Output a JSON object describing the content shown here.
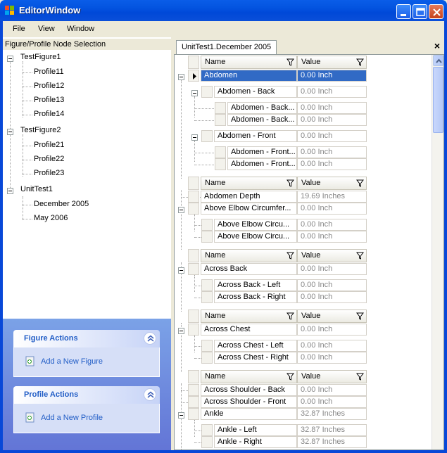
{
  "window": {
    "title": "EditorWindow"
  },
  "menu": [
    "File",
    "View",
    "Window"
  ],
  "left": {
    "header": "Figure/Profile Node Selection",
    "tree": [
      {
        "label": "TestFigure1",
        "children": [
          "Profile11",
          "Profile12",
          "Profile13",
          "Profile14"
        ]
      },
      {
        "label": "TestFigure2",
        "children": [
          "Profile21",
          "Profile22",
          "Profile23"
        ]
      },
      {
        "label": "UnitTest1",
        "children": [
          "December 2005",
          "May 2006"
        ]
      }
    ]
  },
  "tasks": {
    "figure": {
      "title": "Figure Actions",
      "link": "Add a New Figure"
    },
    "profile": {
      "title": "Profile Actions",
      "link": "Add a New Profile"
    }
  },
  "right": {
    "tab": "UnitTest1.December 2005",
    "close": "×",
    "headers": {
      "name": "Name",
      "value": "Value"
    },
    "rows": [
      {
        "name": "Abdomen",
        "value": "0.00 Inch"
      },
      {
        "name": "Abdomen - Back",
        "value": "0.00 Inch"
      },
      {
        "name": "Abdomen - Back...",
        "value": "0.00 Inch"
      },
      {
        "name": "Abdomen - Back...",
        "value": "0.00 Inch"
      },
      {
        "name": "Abdomen - Front",
        "value": "0.00 Inch"
      },
      {
        "name": "Abdomen  - Front...",
        "value": "0.00 Inch"
      },
      {
        "name": "Abdomen - Front...",
        "value": "0.00 Inch"
      },
      {
        "name": "Abdomen Depth",
        "value": "19.69 Inches"
      },
      {
        "name": "Above Elbow Circumfer...",
        "value": "0.00 Inch"
      },
      {
        "name": "Above Elbow Circu...",
        "value": "0.00 Inch"
      },
      {
        "name": "Above Elbow Circu...",
        "value": "0.00 Inch"
      },
      {
        "name": "Across Back",
        "value": "0.00 Inch"
      },
      {
        "name": "Across Back - Left",
        "value": "0.00 Inch"
      },
      {
        "name": "Across Back - Right",
        "value": "0.00 Inch"
      },
      {
        "name": "Across Chest",
        "value": "0.00 Inch"
      },
      {
        "name": "Across Chest - Left",
        "value": "0.00 Inch"
      },
      {
        "name": "Across Chest - Right",
        "value": "0.00 Inch"
      },
      {
        "name": "Across Shoulder - Back",
        "value": "0.00 Inch"
      },
      {
        "name": "Across Shoulder - Front",
        "value": "0.00 Inch"
      },
      {
        "name": "Ankle",
        "value": "32.87 Inches"
      },
      {
        "name": "Ankle - Left",
        "value": "32.87 Inches"
      },
      {
        "name": "Ankle - Right",
        "value": "32.87 Inches"
      }
    ]
  },
  "colors": {
    "selection": "#316ac5",
    "titlebar": "#0353df",
    "taskpane": "#7ba2e7"
  }
}
